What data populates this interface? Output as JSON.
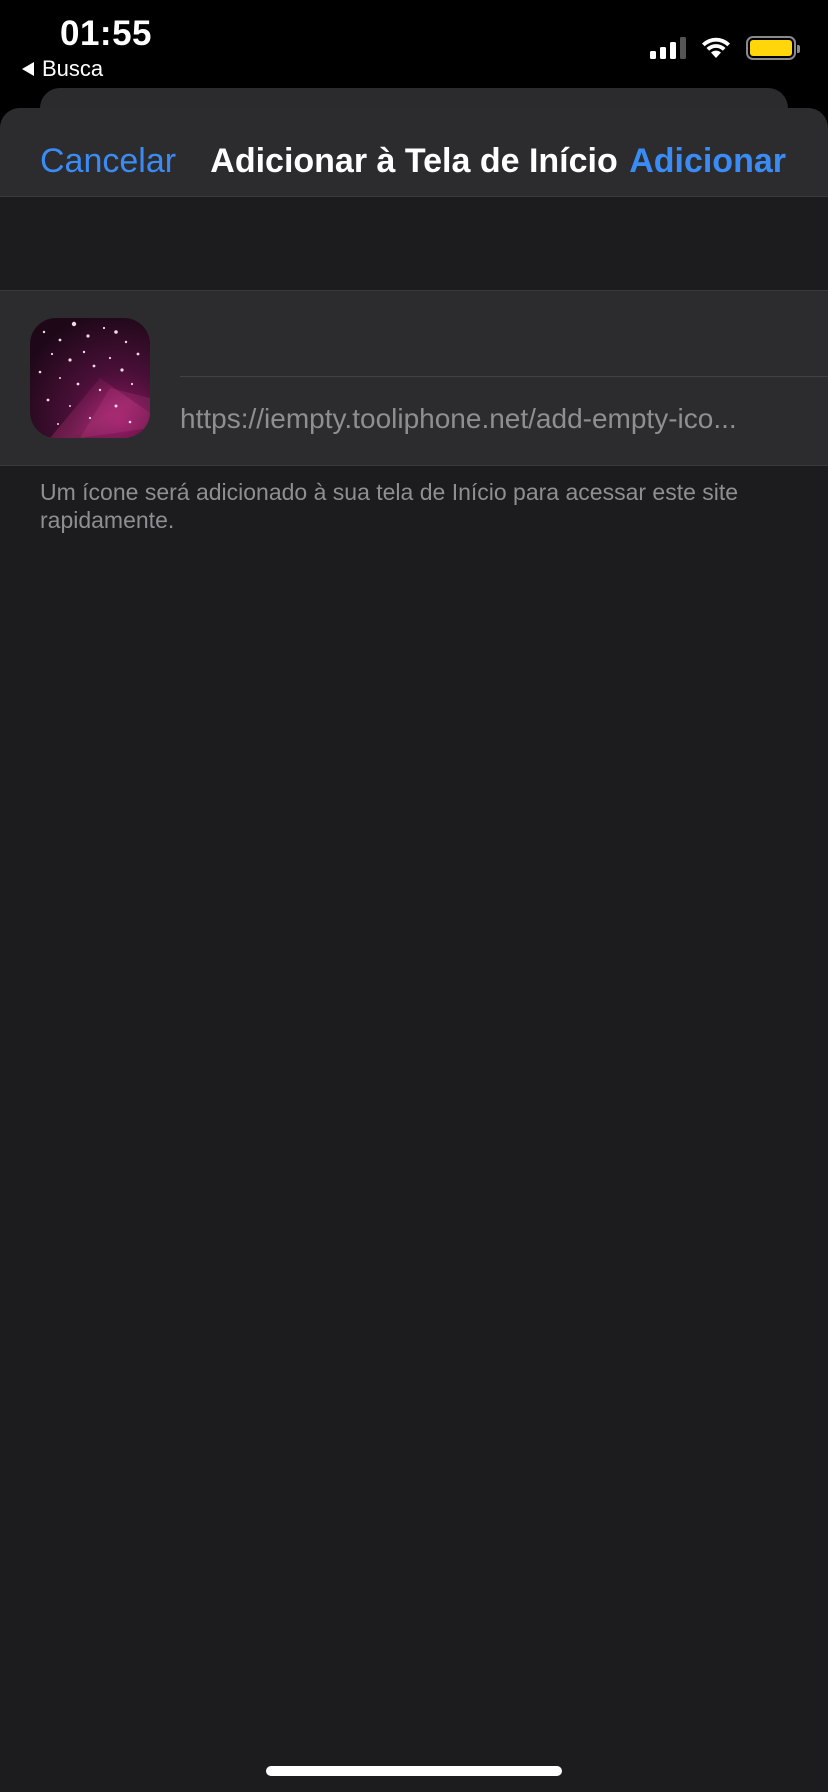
{
  "status_bar": {
    "time": "01:55",
    "back_app_label": "Busca",
    "icons": [
      "cellular-signal-icon",
      "wifi-icon",
      "battery-icon"
    ],
    "battery_color": "#ffd60a"
  },
  "sheet": {
    "nav": {
      "cancel_label": "Cancelar",
      "title": "Adicionar à Tela de Início",
      "add_label": "Adicionar",
      "accent_color": "#3a8cf4"
    },
    "form": {
      "app_icon": "starfield-web-clip-icon",
      "name_value": "",
      "url": "https://iempty.tooliphone.net/add-empty-ico..."
    },
    "footer_note": "Um ícone será adicionado à sua tela de Início para acessar este site rapidamente."
  }
}
